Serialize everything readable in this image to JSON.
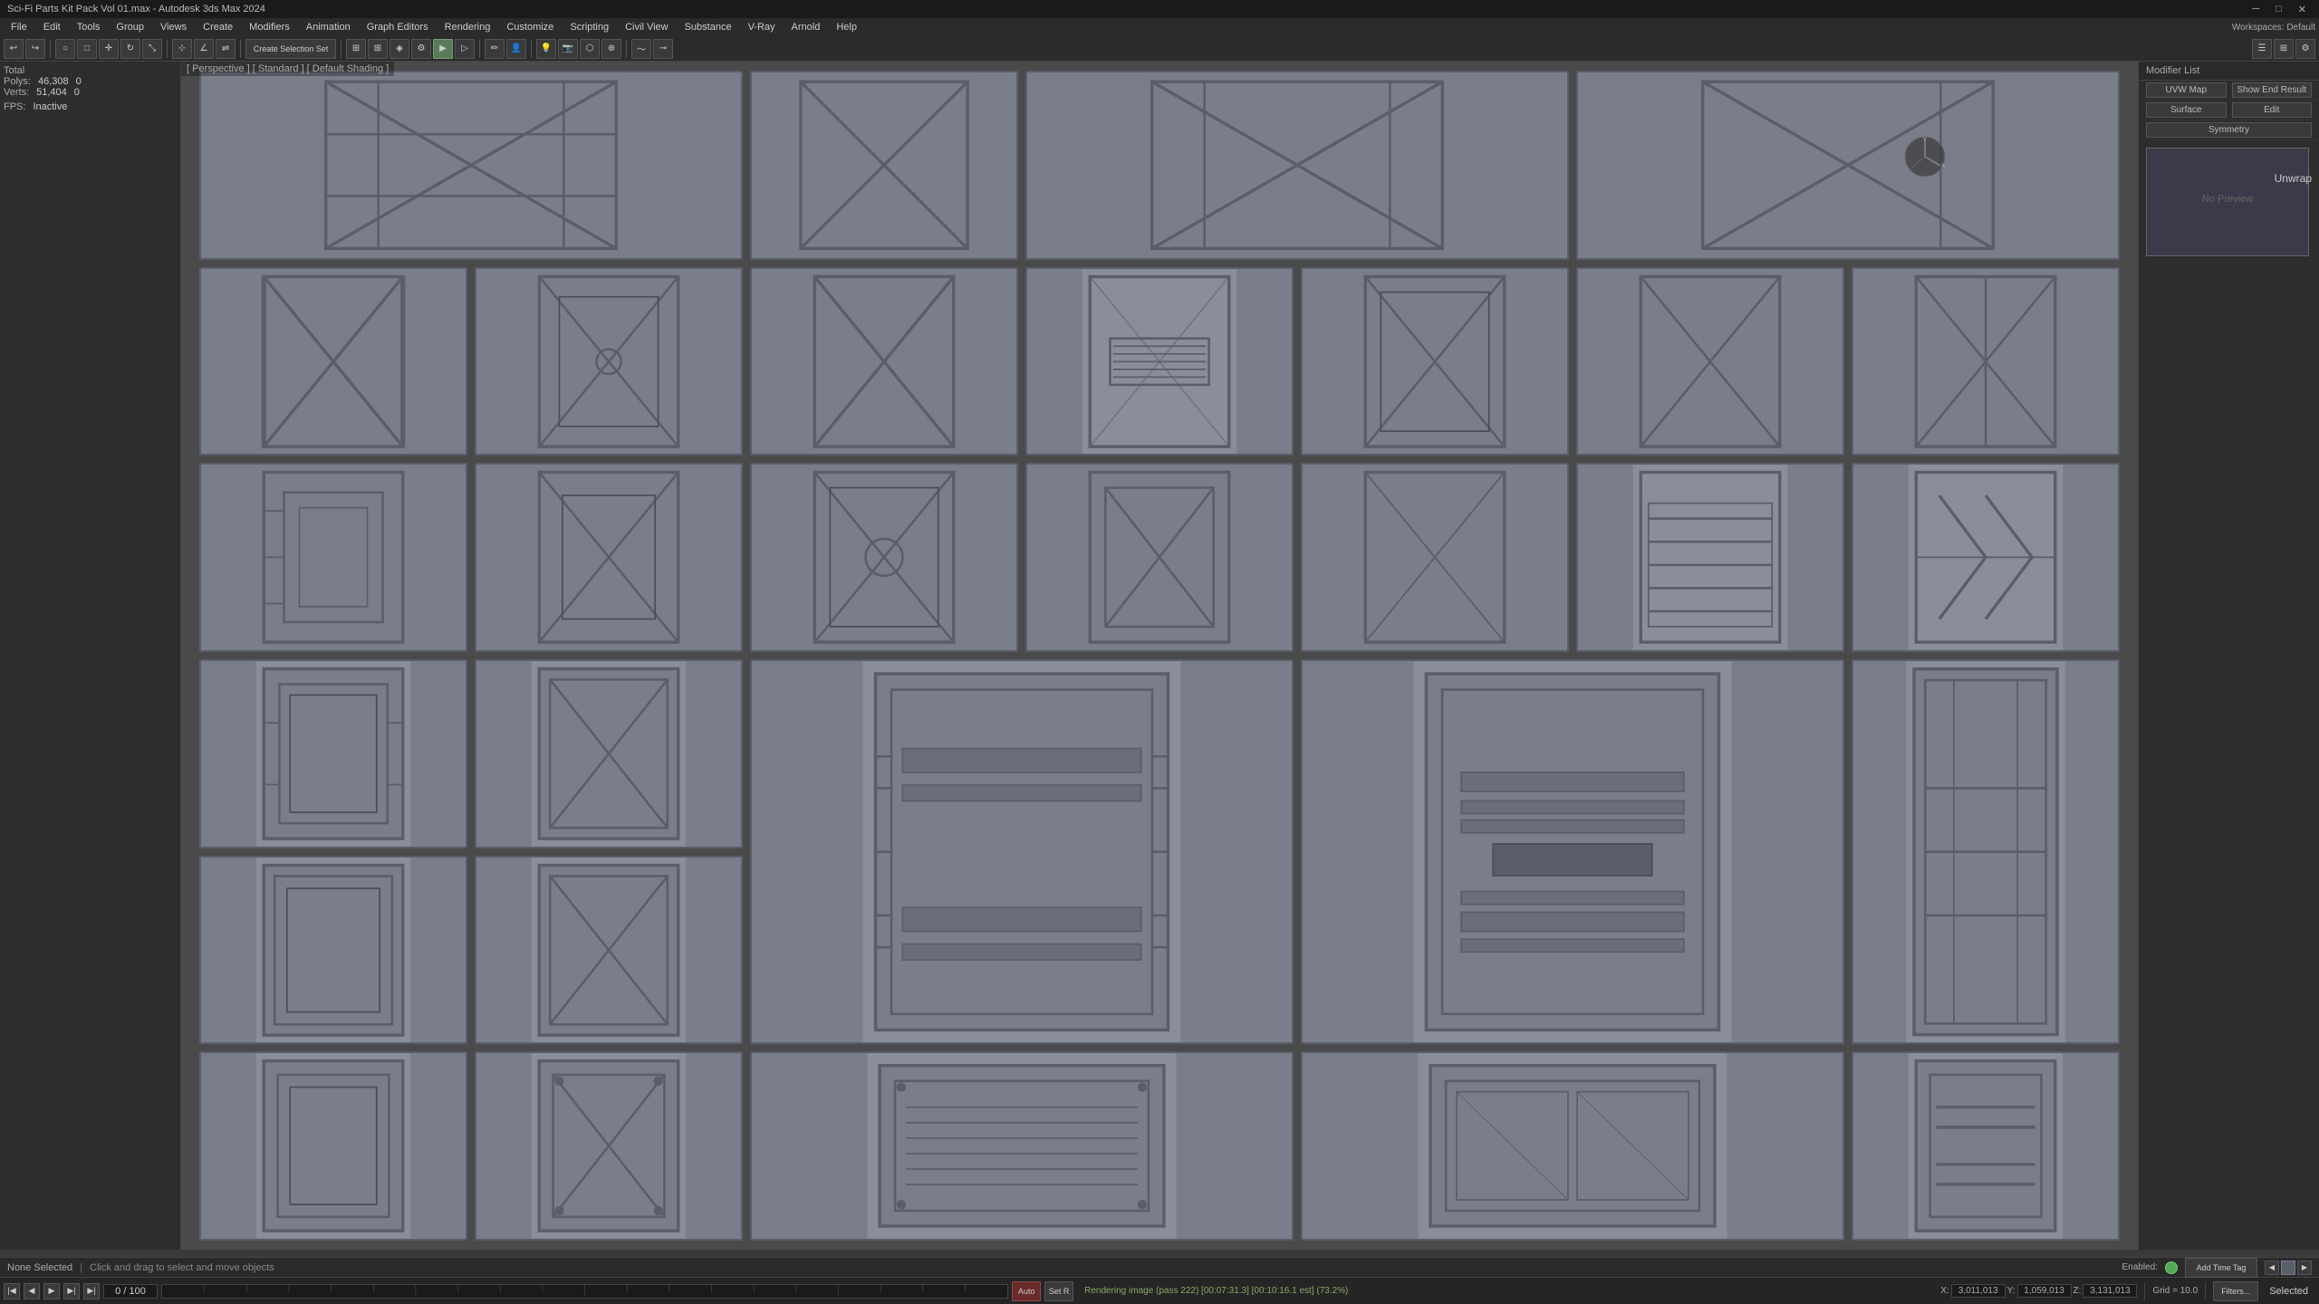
{
  "titleBar": {
    "title": "Sci-Fi Parts Kit Pack Vol 01.max - Autodesk 3ds Max 2024"
  },
  "menuBar": {
    "items": [
      "File",
      "Edit",
      "Tools",
      "Group",
      "Views",
      "Create",
      "Modifiers",
      "Animation",
      "Graph Editors",
      "Rendering",
      "Customize",
      "Scripting",
      "Civil View",
      "Substance",
      "V-Ray",
      "Arnold",
      "Help"
    ]
  },
  "stats": {
    "total_label": "Total",
    "polys_label": "Polys:",
    "polys_value": "46,308",
    "polys_extra": "0",
    "verts_label": "Verts:",
    "verts_value": "51,404",
    "verts_extra": "0",
    "fps_label": "FPS:",
    "fps_value": "Inactive"
  },
  "viewport": {
    "label": "[ Perspective ] [ Standard ] [ Default Shading ]"
  },
  "rightPanel": {
    "header": "Modifier List",
    "uvw_map": "UVW Map",
    "show_end_result": "Show End Result",
    "surface": "Surface",
    "symmetry": "Symmetry",
    "edit": "Edit",
    "unwrap_label": "Unwrap"
  },
  "timeline": {
    "counter": "0 / 100",
    "auto_label": "Auto",
    "set_r_label": "Set R"
  },
  "statusBar": {
    "render_info": "Rendering image (pass 222) [00:07:31.3] [00:10:16.1 est] (73.2%)",
    "selection": "None Selected",
    "hint": "Click and drag to select and move objects",
    "selected": "Selected",
    "grid_label": "Grid = 10.0",
    "add_time_tag": "Add Time Tag",
    "enabled": "Enabled:",
    "filters_label": "Filters..."
  },
  "coordinates": {
    "x_label": "X:",
    "x_value": "3,011,013",
    "y_label": "Y:",
    "y_value": "1,059,013",
    "z_label": "Z:",
    "z_value": "3,131,013"
  },
  "workspaces": {
    "label": "Workspaces:",
    "value": "Default"
  }
}
